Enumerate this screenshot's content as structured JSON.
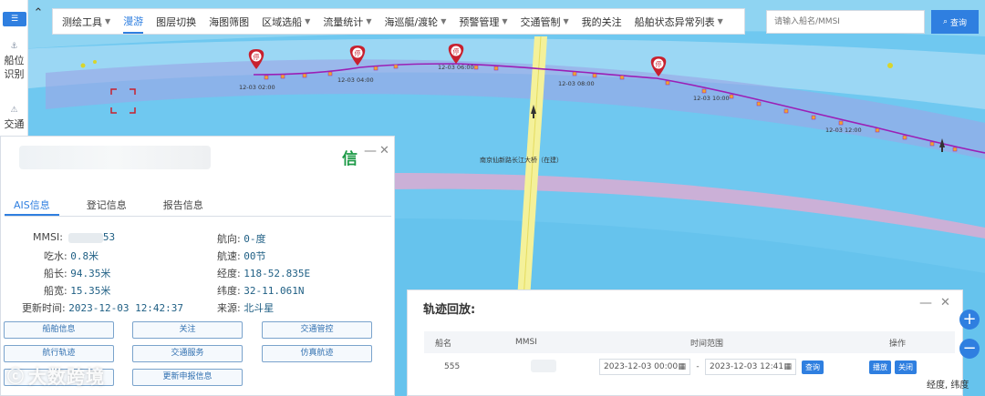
{
  "nav": {
    "collapse_label": "☰",
    "items": [
      {
        "icon": "ship-icon",
        "label": "船位识别"
      },
      {
        "icon": "traffic-icon",
        "label": "交通"
      }
    ]
  },
  "topmenu": {
    "items": [
      {
        "label": "测绘工具",
        "dropdown": true
      },
      {
        "label": "漫游",
        "dropdown": false,
        "active": true
      },
      {
        "label": "图层切换",
        "dropdown": false
      },
      {
        "label": "海图筛图",
        "dropdown": false
      },
      {
        "label": "区域选船",
        "dropdown": true
      },
      {
        "label": "流量统计",
        "dropdown": true
      },
      {
        "label": "海巡艇/渡轮",
        "dropdown": true
      },
      {
        "label": "预警管理",
        "dropdown": true
      },
      {
        "label": "交通管制",
        "dropdown": true
      },
      {
        "label": "我的关注",
        "dropdown": false
      },
      {
        "label": "船舶状态异常列表",
        "dropdown": true
      }
    ]
  },
  "search": {
    "placeholder": "请输入船名/MMSI",
    "button_label": "查询"
  },
  "map": {
    "bridge_label": "南京仙新路长江大桥（在建）",
    "stop_marker": "停",
    "track_labels": [
      "12-03 02:00",
      "12-03 04:00",
      "12-03 06:00",
      "12-03 08:00",
      "12-03 10:00",
      "12-03 12:00"
    ],
    "colors": {
      "track": "#9b1fb6",
      "water": "#6fc8f0",
      "channel": "#9aa7e6",
      "bridge": "#f4f19a",
      "marker": "#c8202e"
    }
  },
  "ship_panel": {
    "badge": "信",
    "tabs": [
      "AIS信息",
      "登记信息",
      "报告信息"
    ],
    "fields": {
      "mmsi_label": "MMSI:",
      "mmsi_value": "53",
      "draft_label": "吃水:",
      "draft_value": "0.8米",
      "length_label": "船长:",
      "length_value": "94.35米",
      "width_label": "船宽:",
      "width_value": "15.35米",
      "updated_label": "更新时间:",
      "updated_value": "2023-12-03 12:42:37",
      "heading_label": "航向:",
      "heading_value": "0-度",
      "speed_label": "航速:",
      "speed_value": "00节",
      "lon_label": "经度:",
      "lon_value": "118-52.835E",
      "lat_label": "纬度:",
      "lat_value": "32-11.061N",
      "source_label": "来源:",
      "source_value": "北斗星"
    },
    "buttons": [
      "船舶信息",
      "关注",
      "交通管控",
      "航行轨迹",
      "交通服务",
      "仿真航迹",
      "",
      "更新申报信息"
    ]
  },
  "watermark": {
    "text": "大数跨境"
  },
  "track_panel": {
    "title": "轨迹回放:",
    "columns": [
      "船名",
      "MMSI",
      "时间范围",
      "操作"
    ],
    "row": {
      "name": "555",
      "start": "2023-12-03 00:00",
      "end": "2023-12-03 12:41",
      "query": "查询",
      "play": "播放",
      "close": "关闭"
    }
  },
  "status": {
    "coords_label": "经度, 纬度"
  }
}
